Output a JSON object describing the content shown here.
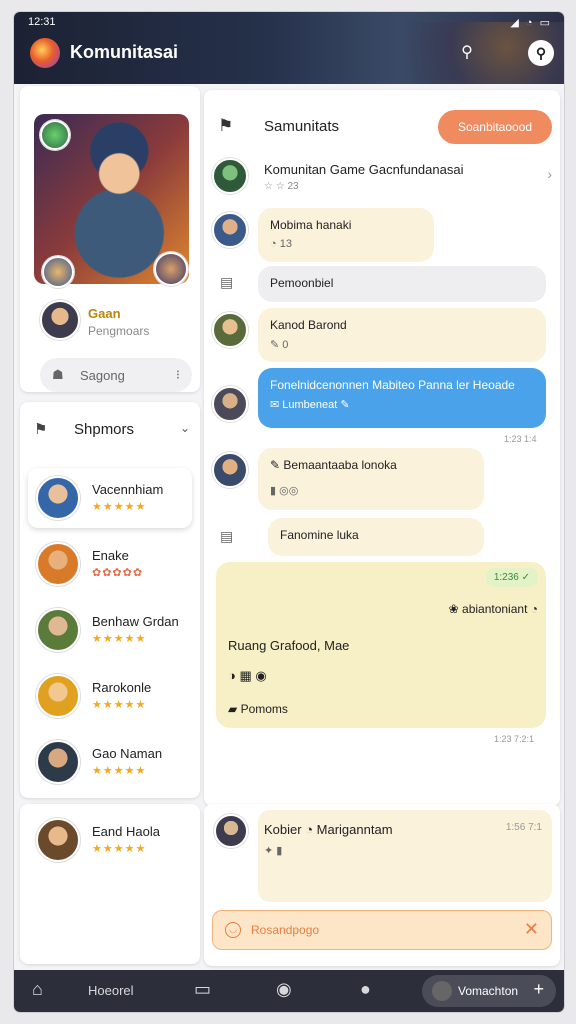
{
  "status": {
    "time": "12:31",
    "left_icons": "▮ ▮▮ ⊞",
    "right_icons": "◢ ◔ ▭"
  },
  "header": {
    "title": "Komunitasai"
  },
  "hero": {
    "user_name": "Gaan",
    "user_sub": "Pengmoars",
    "search_placeholder": "Sagong"
  },
  "friends": {
    "title": "Shpmors",
    "items": [
      {
        "name": "Vacennhiam",
        "stars": "★★★★★"
      },
      {
        "name": "Enake",
        "stars": "✿✿✿✿✿"
      },
      {
        "name": "Benhaw Grdan",
        "stars": "★★★★★"
      },
      {
        "name": "Rarokonle",
        "stars": "★★★★★"
      },
      {
        "name": "Gao Naman",
        "stars": "★★★★★"
      }
    ],
    "bottom_item": {
      "name": "Eand Haola",
      "stars": "★★★★★"
    }
  },
  "chat": {
    "title": "Samunitats",
    "join_button": "Soanbitaoood",
    "group": {
      "name": "Komunitan Game Gacnfundanasai",
      "meta": "☆ ☆ 23"
    },
    "messages": [
      {
        "title": "Mobima hanaki",
        "sub": "◔ 13"
      },
      {
        "title": "Pemoonbiel"
      },
      {
        "title": "Kanod Barond",
        "sub": "✎ 0"
      },
      {
        "title": "Fonelnidcenonnen Mabiteo Panna ler Heoade",
        "sub": "✉ Lumbeneat ✎",
        "time": "1:23 1:4"
      },
      {
        "title": "✎ Bemaantaaba lonoka",
        "sub": "▮ ◎◎"
      },
      {
        "title": "Fanomine luka"
      }
    ],
    "big_message": {
      "time_badge": "1:236 ✓",
      "line1": "❀ abiantoniant ◔",
      "line2": "Ruang Grafood, Mae",
      "emoji_row": "◑ ▦ ◉",
      "line3": "▰ Pomoms",
      "time": "1:23 7:2:1"
    }
  },
  "composer": {
    "name": "Kobier ◔ Mariganntam",
    "time": "1:56 7:1",
    "icons": "✦ ▮",
    "placeholder": "Rosandpogo"
  },
  "nav": {
    "items": [
      {
        "label": ""
      },
      {
        "label": "Hoeorel"
      },
      {
        "label": ""
      },
      {
        "label": ""
      },
      {
        "label": ""
      }
    ],
    "action_label": "Vomachton"
  },
  "colors": {
    "accent": "#f08a5f",
    "bubble_blue": "#4aa3ea",
    "cream": "#fbf2dc"
  }
}
